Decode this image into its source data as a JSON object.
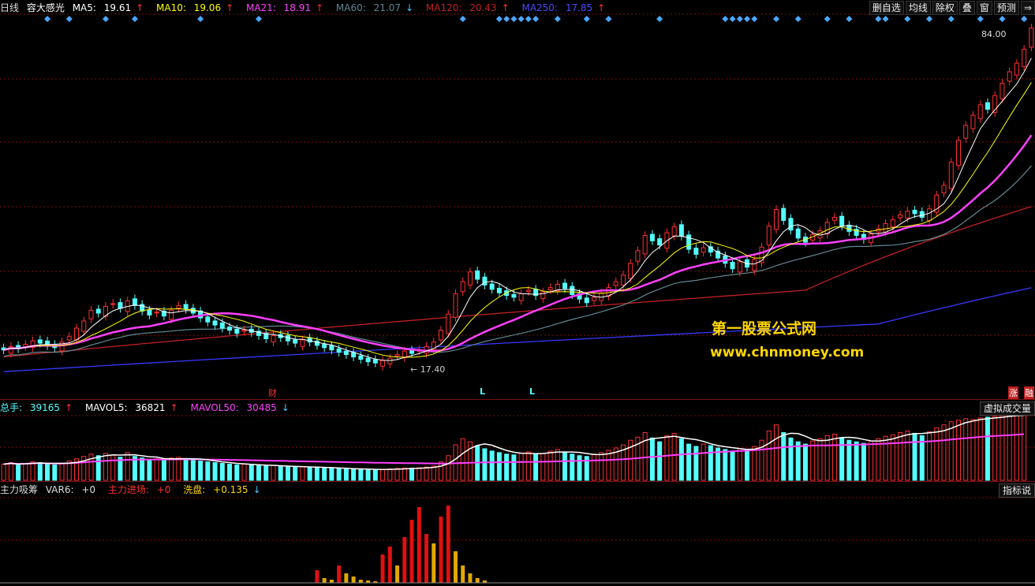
{
  "colors": {
    "up": "#ff3030",
    "down": "#54ffff",
    "ma5": "#ffffff",
    "ma10": "#ffff00",
    "ma21": "#ff40ff",
    "ma60": "#608890",
    "ma120": "#c02020",
    "ma250": "#3838ff",
    "grid": "#7a1010",
    "diamond": "#4aa8ff",
    "watermark": "#ffd700"
  },
  "main": {
    "period": "日线",
    "name": "容大感光",
    "ma5_label": "MA5:",
    "ma5_value": "19.61",
    "ma5_arrow": "↑",
    "ma10_label": "MA10:",
    "ma10_value": "19.06",
    "ma10_arrow": "↑",
    "ma21_label": "MA21:",
    "ma21_value": "18.91",
    "ma21_arrow": "↑",
    "ma60_label": "MA60:",
    "ma60_value": "21.07",
    "ma60_arrow": "↓",
    "ma120_label": "MA120:",
    "ma120_value": "20.43",
    "ma120_arrow": "↑",
    "ma250_label": "MA250:",
    "ma250_value": "17.85",
    "ma250_arrow": "↑",
    "high_label": "84.00",
    "low_label": "17.40",
    "marker_cai": "财",
    "marker_l1": "L",
    "marker_l2": "L",
    "marker_zhang": "涨",
    "marker_rong": "融"
  },
  "toolbar": {
    "del_self": "删自选",
    "junxian": "均线",
    "chuquan": "除权",
    "die": "叠",
    "chuang": "窗",
    "yuce": "预测",
    "more": "⇒"
  },
  "volume": {
    "total_label": "总手:",
    "total_value": "39165",
    "total_arrow": "↑",
    "mavol5_label": "MAVOL5:",
    "mavol5_value": "36821",
    "mavol5_arrow": "↑",
    "mavol50_label": "MAVOL50:",
    "mavol50_value": "30485",
    "mavol50_arrow": "↓",
    "virtual_btn": "虚拟成交量"
  },
  "indicator": {
    "name": "主力吸筹",
    "var6_label": "VAR6:",
    "var6_value": "+0",
    "zlj_label": "主力进场:",
    "zlj_value": "+0",
    "xp_label": "洗盘:",
    "xp_value": "+0.135",
    "xp_arrow": "↓",
    "explain_btn": "指标说"
  },
  "watermark": {
    "title": "第一股票公式网",
    "url": "www.chnmoney.com"
  },
  "chart_data": {
    "type": "candlestick",
    "price_high": 84.0,
    "price_low": 17.4,
    "closes": [
      18.6,
      18.9,
      18.7,
      19.1,
      19.4,
      19.2,
      19.0,
      18.8,
      19.3,
      19.8,
      20.6,
      21.3,
      22.4,
      22.1,
      22.8,
      23.1,
      22.6,
      23.4,
      22.9,
      22.3,
      21.9,
      22.2,
      21.8,
      22.4,
      22.9,
      22.5,
      22.1,
      21.6,
      21.2,
      20.9,
      20.6,
      20.4,
      20.1,
      20.4,
      20.2,
      19.9,
      19.6,
      19.9,
      19.7,
      19.4,
      19.2,
      19.5,
      19.3,
      19.0,
      18.8,
      18.6,
      18.4,
      18.2,
      18.0,
      17.8,
      17.6,
      17.5,
      17.7,
      17.9,
      18.2,
      18.5,
      18.3,
      18.6,
      18.9,
      19.3,
      20.4,
      22.0,
      24.2,
      25.6,
      26.8,
      25.9,
      25.2,
      24.7,
      24.3,
      24.0,
      23.8,
      24.2,
      24.6,
      24.0,
      24.4,
      24.9,
      25.3,
      24.8,
      24.1,
      23.6,
      23.2,
      23.8,
      24.3,
      24.9,
      25.6,
      26.4,
      27.9,
      29.6,
      31.8,
      31.0,
      30.4,
      32.2,
      33.1,
      31.7,
      29.8,
      29.1,
      30.0,
      29.4,
      28.6,
      27.9,
      27.2,
      28.1,
      27.4,
      28.4,
      30.1,
      33.2,
      35.9,
      34.1,
      32.6,
      31.4,
      30.8,
      31.9,
      32.5,
      33.8,
      34.6,
      33.2,
      32.4,
      31.8,
      31.2,
      32.0,
      32.8,
      33.6,
      34.2,
      35.0,
      35.6,
      35.2,
      34.6,
      36.0,
      38.4,
      40.2,
      44.8,
      49.6,
      53.2,
      55.8,
      58.6,
      57.4,
      61.2,
      64.8,
      68.4,
      71.2,
      76.0,
      84.0
    ],
    "volume": [
      21000,
      23000,
      20000,
      22000,
      24000,
      23000,
      21000,
      20000,
      22000,
      25000,
      28000,
      31000,
      34000,
      32000,
      35000,
      33000,
      30000,
      36000,
      31000,
      29000,
      27000,
      28000,
      26000,
      29000,
      30000,
      28000,
      26000,
      25000,
      24000,
      23000,
      22000,
      21000,
      20000,
      21000,
      20000,
      19000,
      18500,
      19000,
      18000,
      17500,
      17000,
      17500,
      17000,
      16500,
      16000,
      15500,
      15000,
      14800,
      14500,
      14200,
      14000,
      13800,
      14200,
      14800,
      15500,
      16000,
      15800,
      16400,
      17200,
      18500,
      24000,
      32000,
      46000,
      54000,
      50000,
      45000,
      41000,
      38000,
      36000,
      34000,
      33000,
      35000,
      37000,
      34000,
      35000,
      38000,
      40000,
      37000,
      34000,
      32000,
      31000,
      34000,
      36000,
      39000,
      42000,
      46000,
      52000,
      56000,
      62000,
      55000,
      50000,
      58000,
      61000,
      54000,
      47000,
      44000,
      47000,
      45000,
      42000,
      40000,
      38000,
      41000,
      39000,
      44000,
      52000,
      64000,
      72000,
      62000,
      55000,
      50000,
      47000,
      51000,
      54000,
      58000,
      60000,
      55000,
      52000,
      50000,
      48000,
      51000,
      54000,
      57000,
      59000,
      62000,
      64000,
      61000,
      58000,
      63000,
      68000,
      72000,
      76000,
      78000,
      80000,
      79000,
      81000,
      82000,
      83000,
      84000,
      85000,
      86000,
      84000
    ],
    "indicator": [
      0,
      0,
      0,
      0,
      0,
      0,
      0,
      0,
      0,
      0,
      0,
      0,
      0,
      0,
      0,
      0,
      0,
      0,
      0,
      0,
      0,
      0,
      0,
      0,
      0,
      0,
      0,
      0,
      0,
      0,
      0,
      0,
      0,
      0,
      0,
      0,
      0,
      0,
      0,
      0,
      0,
      0,
      0,
      0,
      0,
      0,
      0,
      0,
      0,
      0,
      0,
      0,
      0,
      0,
      0,
      0,
      0,
      0,
      0,
      0,
      0,
      0,
      0,
      0,
      0,
      0,
      0,
      0,
      0,
      0,
      0,
      0,
      0,
      0,
      0,
      0,
      0,
      0,
      0,
      0,
      0,
      0,
      0,
      0,
      0,
      0,
      0,
      0,
      0,
      0,
      0,
      0,
      0,
      0,
      0,
      0,
      0,
      0,
      0,
      0,
      0,
      0,
      0,
      0,
      0,
      0,
      0,
      0,
      0,
      0,
      0,
      0,
      0,
      0,
      0,
      0,
      0,
      0,
      0,
      0,
      0,
      0,
      0,
      0,
      0,
      0,
      0,
      0,
      0,
      0,
      0,
      0,
      0,
      0,
      0,
      0,
      0,
      0,
      0,
      0,
      0,
      0,
      0,
      0
    ]
  }
}
